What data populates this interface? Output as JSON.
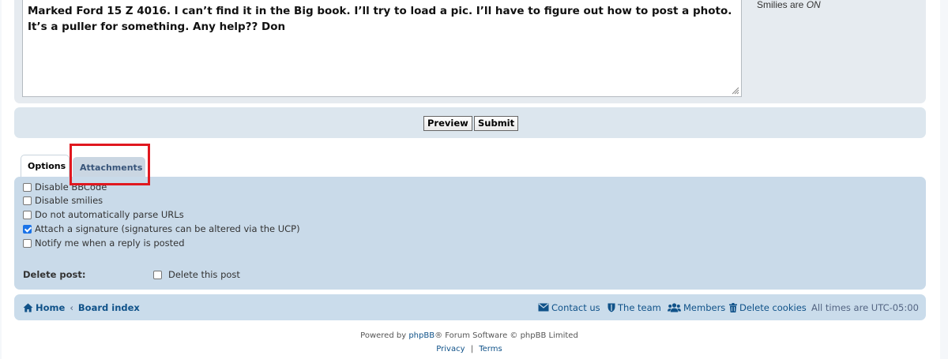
{
  "message": {
    "text": "Marked Ford 15 Z 4016. I can’t find it in the Big book. I’ll try to load a pic. I’ll have to figure out how to post a photo. It’s a puller for something. Any help?? Don"
  },
  "side_info": {
    "smilies_prefix": "Smilies are ",
    "smilies_status": "ON"
  },
  "buttons": {
    "preview": "Preview",
    "submit": "Submit"
  },
  "tabs": [
    {
      "label": "Options",
      "active": true
    },
    {
      "label": "Attachments",
      "active": false
    }
  ],
  "options": [
    {
      "label": "Disable BBCode",
      "checked": false
    },
    {
      "label": "Disable smilies",
      "checked": false
    },
    {
      "label": "Do not automatically parse URLs",
      "checked": false
    },
    {
      "label": "Attach a signature (signatures can be altered via the UCP)",
      "checked": true
    },
    {
      "label": "Notify me when a reply is posted",
      "checked": false
    }
  ],
  "delete_post": {
    "label": "Delete post:",
    "option": "Delete this post",
    "checked": false
  },
  "navbar": {
    "home": "Home",
    "separator": "‹",
    "board_index": "Board index",
    "contact": "Contact us",
    "team": "The team",
    "members": "Members",
    "delete_cookies": "Delete cookies",
    "timezone": "All times are UTC-05:00"
  },
  "footer": {
    "powered_prefix": "Powered by ",
    "phpbb": "phpBB",
    "powered_suffix": "® Forum Software © phpBB Limited",
    "privacy": "Privacy",
    "sep": "|",
    "terms": "Terms"
  },
  "colors": {
    "highlight": "#e0181f",
    "link": "#105289",
    "checkbox_checked": "#1a73e8"
  },
  "icons": {
    "home": "home-icon",
    "contact": "envelope-icon",
    "team": "shield-icon",
    "members": "users-icon",
    "cookies": "trash-icon",
    "resize": "resize-grip-icon"
  }
}
